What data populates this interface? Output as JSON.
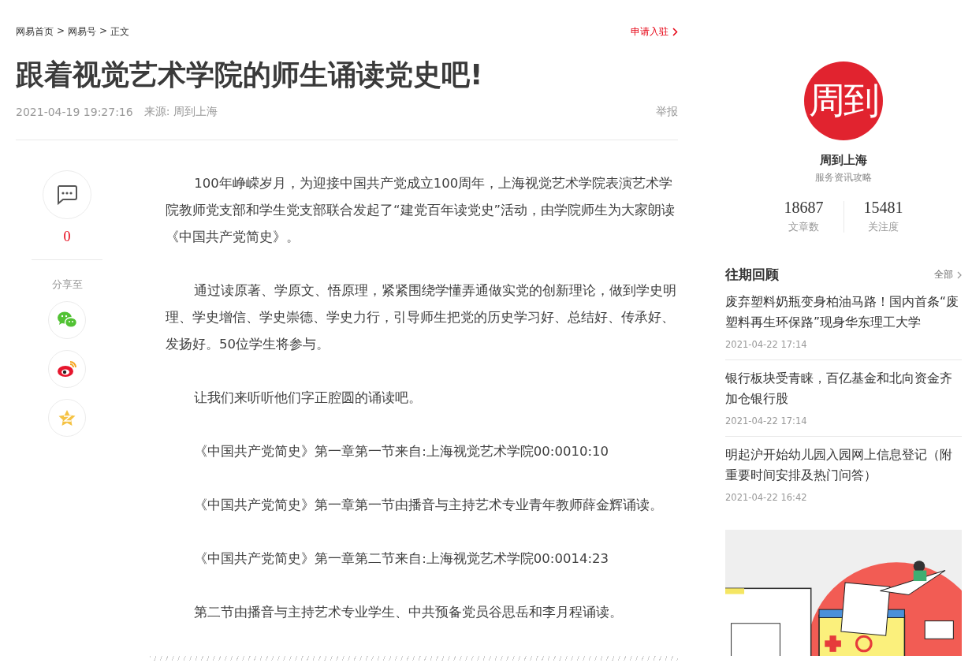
{
  "breadcrumb": [
    "网易首页",
    "网易号",
    "正文"
  ],
  "breadcrumb_separator": ">",
  "apply_link": "申请入驻",
  "title": "跟着视觉艺术学院的师生诵读党史吧!",
  "meta": {
    "datetime": "2021-04-19 19:27:16",
    "source": "来源: 周到上海",
    "report": "举报"
  },
  "rail": {
    "comment_count": "0",
    "share_label": "分享至",
    "share": [
      {
        "kind": "wechat"
      },
      {
        "kind": "weibo"
      },
      {
        "kind": "qzone"
      }
    ]
  },
  "paragraphs": [
    "100年峥嵘岁月，为迎接中国共产党成立100周年，上海视觉艺术学院表演艺术学院教师党支部和学生党支部联合发起了“建党百年读党史”活动，由学院师生为大家朗读《中国共产党简史》。",
    "通过读原著、学原文、悟原理，紧紧围绕学懂弄通做实党的创新理论，做到学史明理、学史增信、学史崇德、学史力行，引导师生把党的历史学习好、总结好、传承好、发扬好。50位学生将参与。",
    "让我们来听听他们字正腔圆的诵读吧。",
    "《中国共产党简史》第一章第一节来自:上海视觉艺术学院00:0010:10",
    "《中国共产党简史》第一章第一节由播音与主持艺术专业青年教师薛金辉诵读。",
    "《中国共产党简史》第一章第二节来自:上海视觉艺术学院00:0014:23",
    "第二节由播音与主持艺术专业学生、中共预备党员谷思岳和李月程诵读。"
  ],
  "author": {
    "logo_text": "周到",
    "name": "周到上海",
    "tagline": "服务资讯攻略",
    "stats": [
      {
        "value": "18687",
        "label": "文章数"
      },
      {
        "value": "15481",
        "label": "关注度"
      }
    ]
  },
  "past": {
    "title": "往期回顾",
    "more": "全部",
    "items": [
      {
        "title": "废弃塑料奶瓶变身柏油马路！国内首条“废塑料再生环保路”现身华东理工大学",
        "time": "2021-04-22 17:14"
      },
      {
        "title": "银行板块受青睐，百亿基金和北向资金齐加仓银行股",
        "time": "2021-04-22 17:14"
      },
      {
        "title": "明起沪开始幼儿园入园网上信息登记（附重要时间安排及热门问答）",
        "time": "2021-04-22 16:42"
      }
    ]
  }
}
